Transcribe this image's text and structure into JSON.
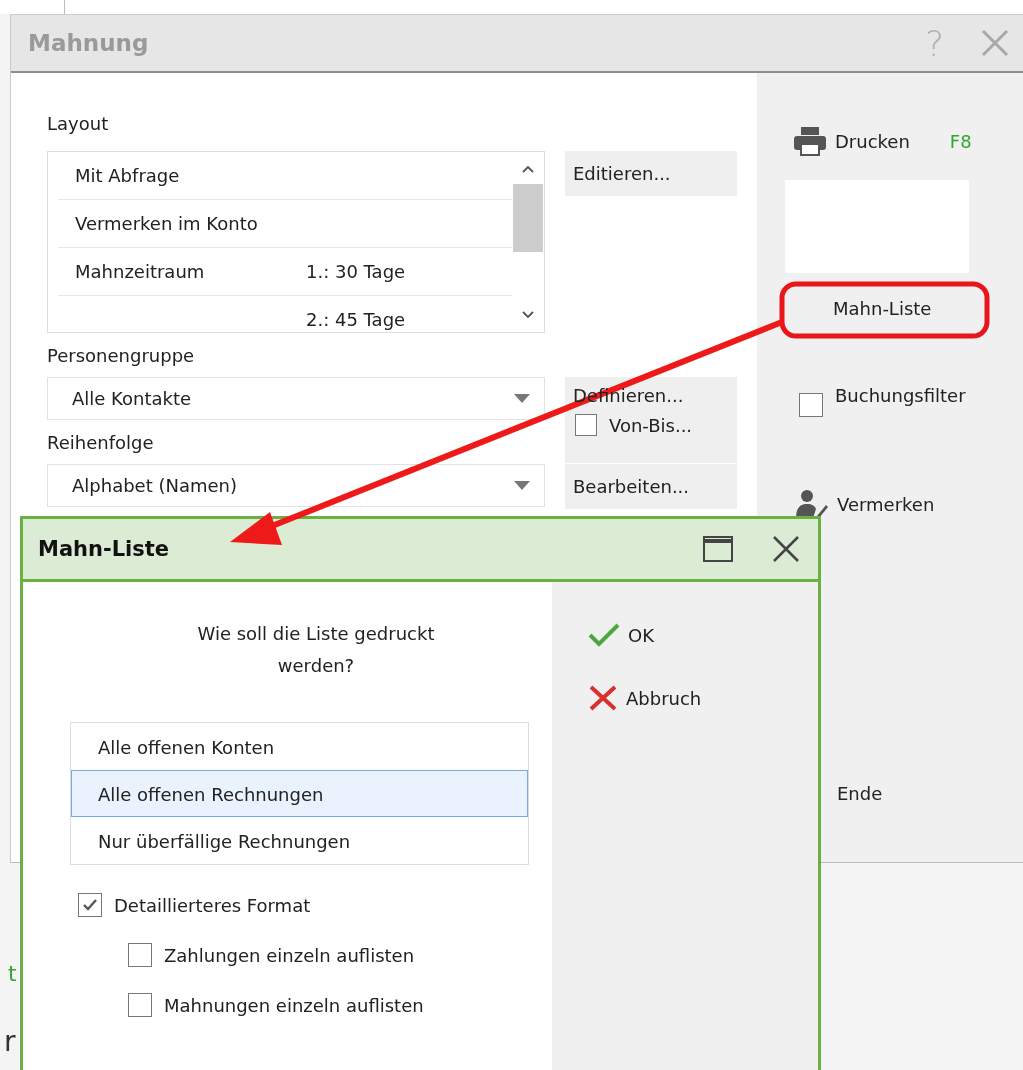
{
  "window": {
    "title": "Mahnung",
    "help": "?"
  },
  "layout": {
    "label": "Layout",
    "rows": [
      {
        "label": "Mit Abfrage"
      },
      {
        "label": "Vermerken im Konto"
      },
      {
        "label": "Mahnzeitraum",
        "value": "1.:  30 Tage"
      },
      {
        "label": "",
        "value": "2.:  45 Tage"
      }
    ],
    "button": "Editieren..."
  },
  "person_group": {
    "label": "Personengruppe",
    "value": "Alle Kontakte",
    "button": "Definieren...",
    "range_check": {
      "label": "Von-Bis...",
      "checked": false
    }
  },
  "order": {
    "label": "Reihenfolge",
    "value": "Alphabet (Namen)",
    "button": "Bearbeiten..."
  },
  "sidebar": {
    "print": {
      "label": "Drucken",
      "shortcut": "F8"
    },
    "list_button": "Mahn-Liste",
    "filter": {
      "label": "Buchungsfilter",
      "checked": false
    },
    "notes": "Vermerken",
    "end": "Ende"
  },
  "fragments": [
    {
      "text": "t",
      "color": "#3aa53a"
    },
    {
      "text": "r",
      "color": "#333333"
    }
  ],
  "dialog": {
    "title": "Mahn-Liste",
    "prompt": "Wie soll die Liste gedruckt werden?",
    "options": [
      {
        "label": "Alle offenen Konten",
        "selected": false
      },
      {
        "label": "Alle offenen Rechnungen",
        "selected": true
      },
      {
        "label": "Nur überfällige Rechnungen",
        "selected": false
      }
    ],
    "checks": [
      {
        "label": "Detaillierteres Format",
        "checked": true,
        "children": [
          {
            "label": "Zahlungen einzeln auflisten",
            "checked": false
          },
          {
            "label": "Mahnungen einzeln auflisten",
            "checked": false
          }
        ]
      }
    ],
    "buttons": [
      {
        "kind": "ok",
        "label": "OK"
      },
      {
        "kind": "cancel",
        "label": "Abbruch"
      }
    ]
  }
}
